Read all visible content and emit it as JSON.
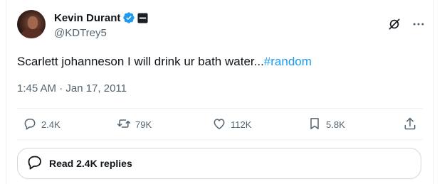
{
  "author": {
    "name": "Kevin Durant",
    "handle": "@KDTrey5"
  },
  "tweet": {
    "text": "Scarlett johanneson I will drink ur bath water...",
    "hashtag": "#random",
    "timestamp": "1:45 AM · Jan 17, 2011"
  },
  "actions": {
    "replies": "2.4K",
    "reposts": "79K",
    "likes": "112K",
    "bookmarks": "5.8K"
  },
  "read_replies": {
    "label": "Read 2.4K replies"
  },
  "colors": {
    "text": "#0f1419",
    "secondary": "#536471",
    "link": "#1d9bf0",
    "border": "#cfd9de",
    "verified": "#1d9bf0"
  },
  "icons": [
    "verified-badge-icon",
    "affiliate-badge-icon",
    "grok-icon",
    "more-icon",
    "reply-icon",
    "repost-icon",
    "like-icon",
    "bookmark-icon",
    "share-icon",
    "chat-bubble-icon"
  ]
}
